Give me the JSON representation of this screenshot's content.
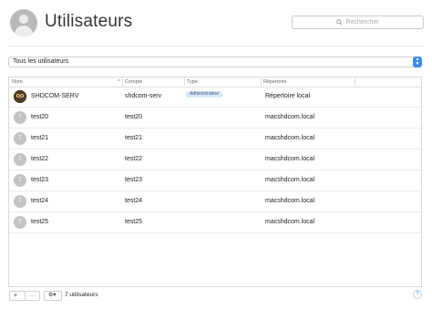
{
  "header": {
    "title": "Utilisateurs",
    "search_placeholder": "Rechercher",
    "avatar_icon": "user-silhouette-icon"
  },
  "filter": {
    "selected": "Tous les utilisateurs",
    "arrow_up": "▲",
    "arrow_down": "▼"
  },
  "table": {
    "columns": [
      "Nom",
      "Compte",
      "Type",
      "Répertoire"
    ],
    "sort_indicator": "^",
    "rows": [
      {
        "initial": "",
        "name": "SHDCOM-SERV",
        "account": "shdcom-serv",
        "type": "Administrateur",
        "directory": "Répertoire local",
        "avatar": "owl-photo"
      },
      {
        "initial": "T",
        "name": "test20",
        "account": "test20",
        "type": "",
        "directory": "macshdcom.local"
      },
      {
        "initial": "T",
        "name": "test21",
        "account": "test21",
        "type": "",
        "directory": "macshdcom.local"
      },
      {
        "initial": "T",
        "name": "test22",
        "account": "test22",
        "type": "",
        "directory": "macshdcom.local"
      },
      {
        "initial": "T",
        "name": "test23",
        "account": "test23",
        "type": "",
        "directory": "macshdcom.local"
      },
      {
        "initial": "T",
        "name": "test24",
        "account": "test24",
        "type": "",
        "directory": "macshdcom.local"
      },
      {
        "initial": "T",
        "name": "test25",
        "account": "test25",
        "type": "",
        "directory": "macshdcom.local"
      }
    ]
  },
  "footer": {
    "add_label": "+",
    "remove_label": "—",
    "gear_label": "⚙▾",
    "count": "7 utilisateurs",
    "help_label": "?"
  },
  "colors": {
    "accent": "#3b8cf5",
    "badge_bg": "#d5e7fb"
  }
}
